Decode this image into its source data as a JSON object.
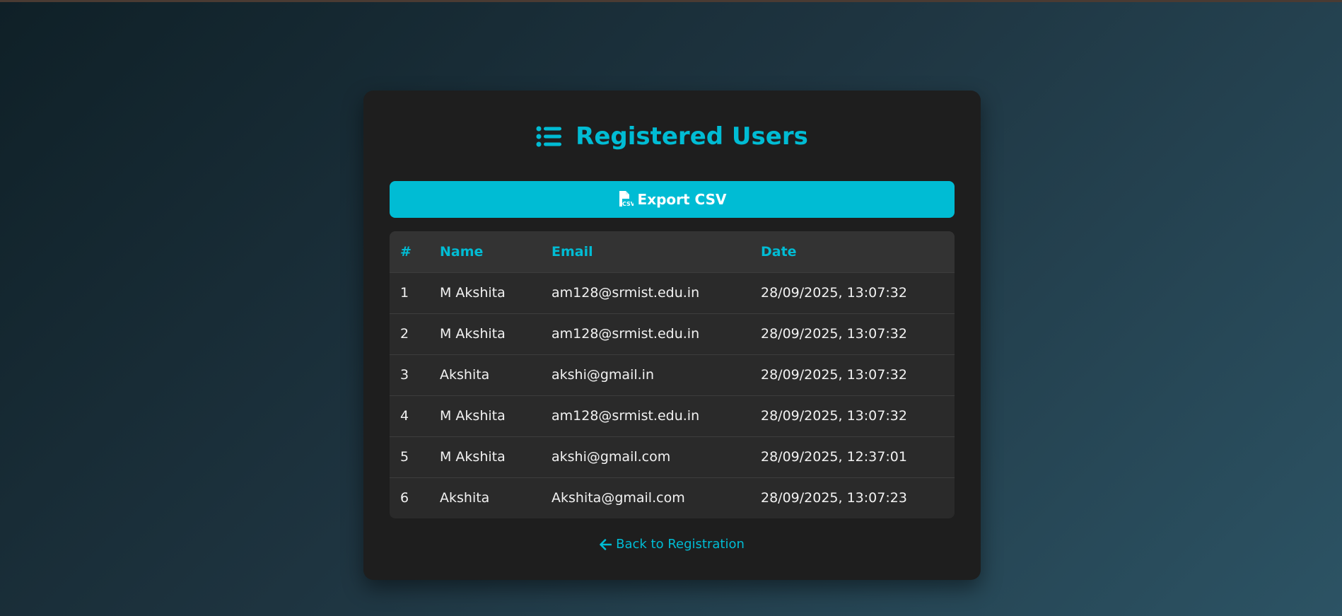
{
  "header": {
    "title": "Registered Users",
    "icon": "list-icon"
  },
  "toolbar": {
    "export_label": "Export CSV",
    "export_icon": "csv-file-icon"
  },
  "table": {
    "columns": [
      "#",
      "Name",
      "Email",
      "Date"
    ],
    "rows": [
      {
        "num": "1",
        "name": "M Akshita",
        "email": "am128@srmist.edu.in",
        "date": "28/09/2025, 13:07:32"
      },
      {
        "num": "2",
        "name": "M Akshita",
        "email": "am128@srmist.edu.in",
        "date": "28/09/2025, 13:07:32"
      },
      {
        "num": "3",
        "name": "Akshita",
        "email": "akshi@gmail.in",
        "date": "28/09/2025, 13:07:32"
      },
      {
        "num": "4",
        "name": "M Akshita",
        "email": "am128@srmist.edu.in",
        "date": "28/09/2025, 13:07:32"
      },
      {
        "num": "5",
        "name": "M Akshita",
        "email": "akshi@gmail.com",
        "date": "28/09/2025, 12:37:01"
      },
      {
        "num": "6",
        "name": "Akshita",
        "email": "Akshita@gmail.com",
        "date": "28/09/2025, 13:07:23"
      }
    ]
  },
  "footer": {
    "back_label": "Back to Registration",
    "back_icon": "arrow-left-icon"
  },
  "colors": {
    "accent": "#00bcd4",
    "card": "#1e1e1e",
    "text": "#f2f2f2"
  }
}
